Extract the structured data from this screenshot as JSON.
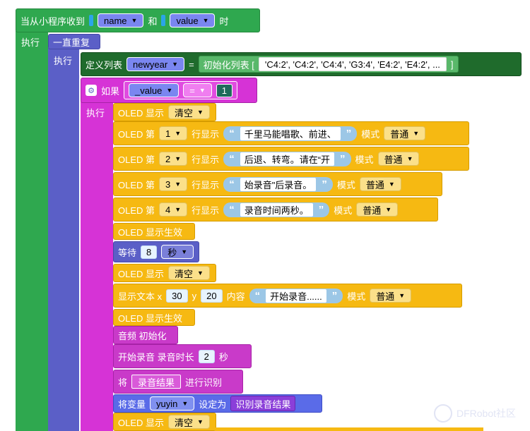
{
  "event": {
    "prefix": "当从小程序收到",
    "name_var": "name",
    "and": "和",
    "value_var": "value",
    "suffix": "时",
    "exec": "执行"
  },
  "forever": {
    "label": "一直重复",
    "exec": "执行"
  },
  "define_list": {
    "label": "定义列表",
    "var": "newyear",
    "eq": "=",
    "init_label": "初始化列表 [",
    "items_text": "'C4:2', 'C4:2', 'C4:4', 'G3:4', 'E4:2', 'E4:2', ...",
    "close": "]"
  },
  "if_block": {
    "label": "如果",
    "var": "_value",
    "op": "=",
    "num": "1",
    "exec": "执行"
  },
  "oled_clear_1": {
    "label": "OLED 显示",
    "option": "清空"
  },
  "oled_rows": [
    {
      "prefix": "OLED 第",
      "row": "1",
      "mid": "行显示",
      "text": "千里马能唱歌、前进、",
      "mode_label": "模式",
      "mode": "普通"
    },
    {
      "prefix": "OLED 第",
      "row": "2",
      "mid": "行显示",
      "text": "后退、转弯。请在“开",
      "mode_label": "模式",
      "mode": "普通"
    },
    {
      "prefix": "OLED 第",
      "row": "3",
      "mid": "行显示",
      "text": "始录音\"后录音。",
      "mode_label": "模式",
      "mode": "普通"
    },
    {
      "prefix": "OLED 第",
      "row": "4",
      "mid": "行显示",
      "text": "录音时间两秒。",
      "mode_label": "模式",
      "mode": "普通"
    }
  ],
  "oled_effect_1": {
    "label": "OLED 显示生效"
  },
  "wait": {
    "label": "等待",
    "num": "8",
    "unit": "秒"
  },
  "oled_clear_2": {
    "label": "OLED 显示",
    "option": "清空"
  },
  "show_text": {
    "label": "显示文本 x",
    "x": "30",
    "y_label": "y",
    "y": "20",
    "content_label": "内容",
    "text": "开始录音......",
    "mode_label": "模式",
    "mode": "普通"
  },
  "oled_effect_2": {
    "label": "OLED 显示生效"
  },
  "audio_init": {
    "label": "音频 初始化"
  },
  "record": {
    "label": "开始录音 录音时长",
    "num": "2",
    "unit": "秒"
  },
  "recognize": {
    "prefix": "将",
    "field": "录音结果",
    "suffix": "进行识别"
  },
  "set_var": {
    "label": "将变量",
    "var": "yuyin",
    "set": "设定为",
    "value": "识别录音结果"
  },
  "oled_clear_3": {
    "label": "OLED 显示",
    "option": "清空"
  },
  "watermark": {
    "text": "DFRobot社区"
  },
  "colors": {
    "event_green": "#2fa84f",
    "control_indigo": "#5b5fc7",
    "list_dark_green": "#1f6b2c",
    "logic_magenta": "#d633d6",
    "oled_yellow": "#f6b912",
    "variable_blue": "#5a6be8",
    "speech_purple": "#8b3fd9"
  }
}
